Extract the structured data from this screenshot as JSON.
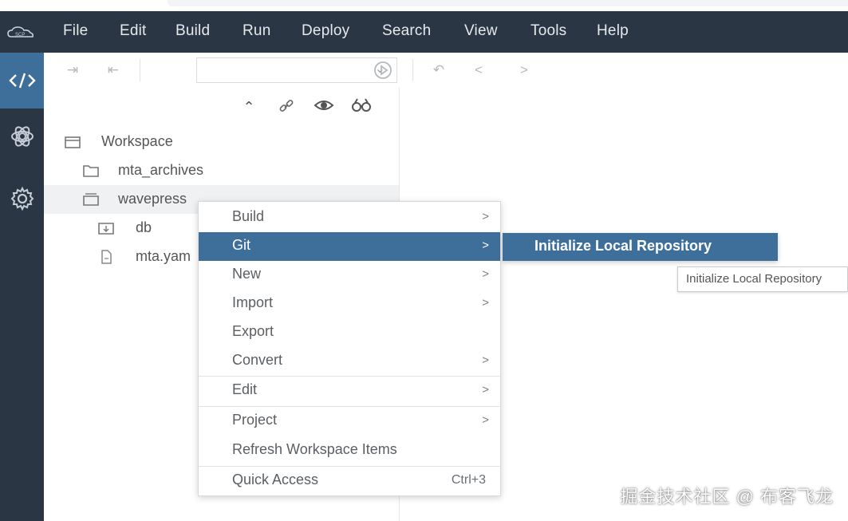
{
  "menubar": {
    "items": [
      "File",
      "Edit",
      "Build",
      "Run",
      "Deploy",
      "Search",
      "View",
      "Tools",
      "Help"
    ]
  },
  "activitybar": {
    "icons": [
      "code-icon",
      "molecule-icon",
      "gear-icon"
    ]
  },
  "toolbar": {
    "run_config_value": ""
  },
  "explorer": {
    "tree": [
      {
        "label": "Workspace",
        "level": 0,
        "icon": "workspace-icon"
      },
      {
        "label": "mta_archives",
        "level": 1,
        "icon": "folder-icon"
      },
      {
        "label": "wavepress",
        "level": 1,
        "icon": "project-icon",
        "selected": true
      },
      {
        "label": "db",
        "level": 2,
        "icon": "db-folder-icon"
      },
      {
        "label": "mta.yam",
        "level": 2,
        "icon": "file-icon"
      }
    ]
  },
  "context_menu": {
    "items": [
      {
        "label": "Build",
        "submenu": true
      },
      {
        "label": "Git",
        "submenu": true,
        "highlighted": true
      },
      {
        "label": "New",
        "submenu": true
      },
      {
        "label": "Import",
        "submenu": true
      },
      {
        "label": "Export",
        "submenu": false
      },
      {
        "label": "Convert",
        "submenu": true
      },
      {
        "label": "Edit",
        "submenu": true
      },
      {
        "label": "Project",
        "submenu": true
      },
      {
        "label": "Refresh Workspace Items",
        "submenu": false
      },
      {
        "label": "Quick Access",
        "submenu": false,
        "shortcut": "Ctrl+3"
      }
    ],
    "arrow_glyph": ">"
  },
  "submenu": {
    "item": "Initialize Local Repository"
  },
  "tooltip": {
    "text": "Initialize Local Repository"
  },
  "watermark": "掘金技术社区 @ 布客飞龙",
  "colors": {
    "menubar_bg": "#2a3644",
    "accent": "#3e6f9b"
  }
}
